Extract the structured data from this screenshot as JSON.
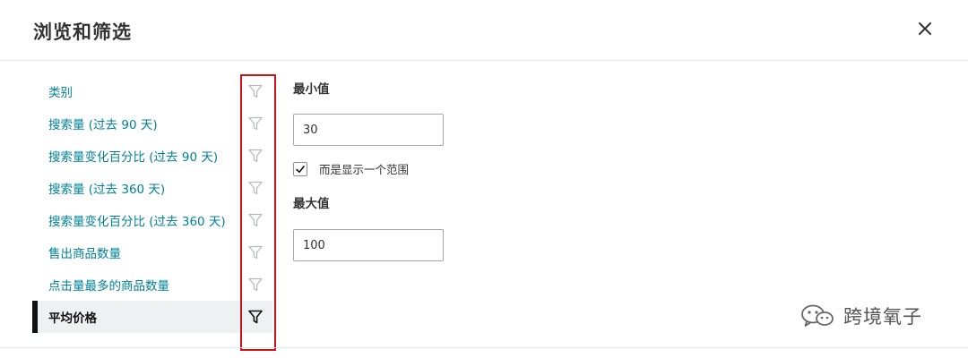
{
  "dialog": {
    "title": "浏览和筛选",
    "close_icon": "close-icon"
  },
  "filters": [
    {
      "label": "类别",
      "icon": "filter-icon",
      "selected": false
    },
    {
      "label": "搜索量 (过去 90 天)",
      "icon": "filter-icon",
      "selected": false
    },
    {
      "label": "搜索量变化百分比 (过去 90 天)",
      "icon": "filter-icon",
      "selected": false
    },
    {
      "label": "搜索量 (过去 360 天)",
      "icon": "filter-icon",
      "selected": false
    },
    {
      "label": "搜索量变化百分比 (过去 360 天)",
      "icon": "filter-icon",
      "selected": false
    },
    {
      "label": "售出商品数量",
      "icon": "filter-icon",
      "selected": false
    },
    {
      "label": "点击量最多的商品数量",
      "icon": "filter-icon",
      "selected": false
    },
    {
      "label": "平均价格",
      "icon": "filter-icon",
      "selected": true
    }
  ],
  "panel": {
    "min_label": "最小值",
    "min_value": "30",
    "range_checkbox_label": "而是显示一个范围",
    "range_checked": true,
    "max_label": "最大值",
    "max_value": "100"
  },
  "watermark": {
    "text": "跨境氧子",
    "icon": "wechat-icon"
  },
  "colors": {
    "link": "#008296",
    "highlight_box": "#d10f1b",
    "selected_bar": "#0f1111",
    "selected_bg": "#eef1f1"
  }
}
